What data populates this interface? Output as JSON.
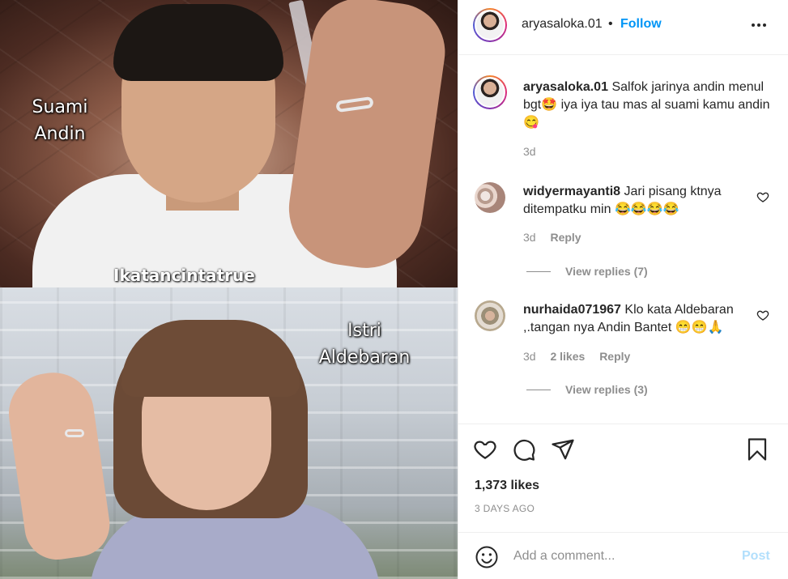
{
  "post": {
    "username": "aryasaloka.01",
    "dot": "•",
    "follow_label": "Follow",
    "image": {
      "caption_top": "Suami Andin",
      "caption_bottom": "Istri Aldebaran",
      "watermark": "Ikatancintatrue"
    },
    "caption": {
      "username": "aryasaloka.01",
      "text": "Salfok jarinya andin menul bgt🤩 iya iya tau mas al suami kamu andin 😋",
      "age": "3d"
    },
    "comments": [
      {
        "username": "widyermayanti8",
        "text": "Jari pisang ktnya ditempatku min 😂😂😂😂",
        "age": "3d",
        "likes": "",
        "reply_label": "Reply",
        "view_replies": "View replies (7)"
      },
      {
        "username": "nurhaida071967",
        "text": "Klo kata Aldebaran ,.tangan nya Andin Bantet 😁😁🙏",
        "age": "3d",
        "likes": "2 likes",
        "reply_label": "Reply",
        "view_replies": "View replies (3)"
      }
    ],
    "likes_count": "1,373 likes",
    "posted_date": "3 DAYS AGO",
    "add_comment_placeholder": "Add a comment...",
    "post_label": "Post"
  },
  "icons": {
    "more": "more-options-icon",
    "like": "heart-icon",
    "comment": "comment-icon",
    "share": "share-icon",
    "save": "bookmark-icon",
    "emoji": "emoji-icon"
  },
  "colors": {
    "follow": "#0095f6",
    "post_disabled": "#b2dffc",
    "secondary_text": "#8e8e8e"
  }
}
